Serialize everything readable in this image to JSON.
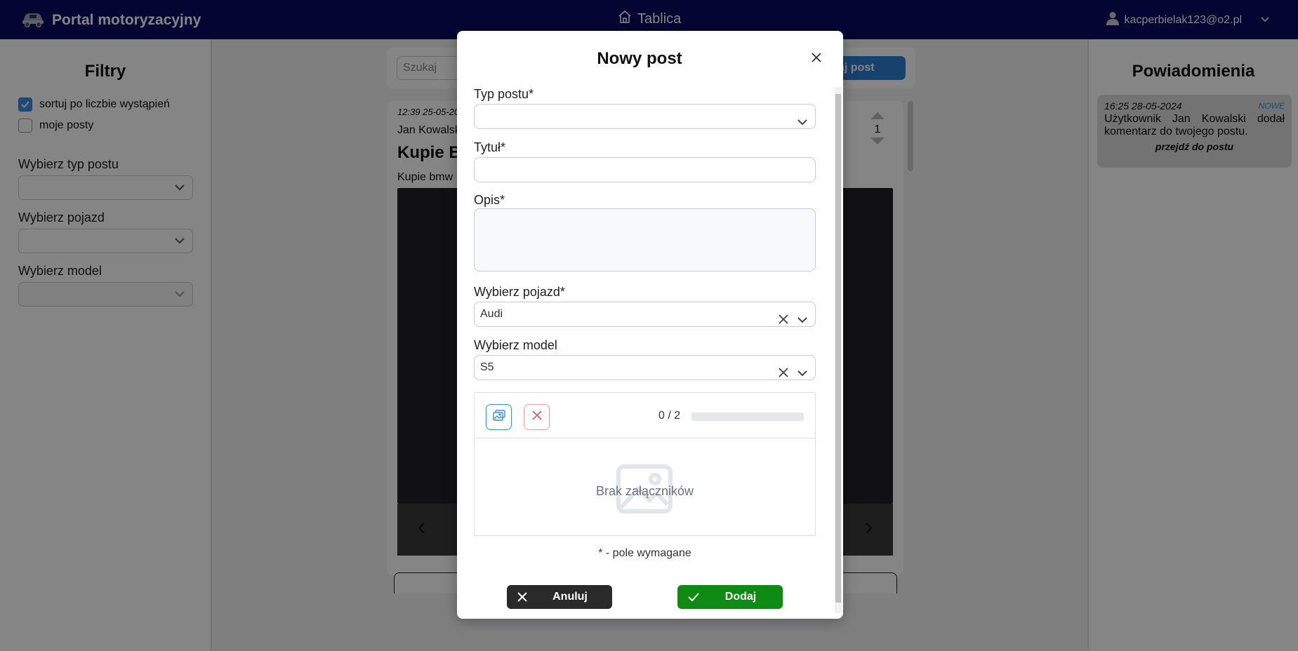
{
  "header": {
    "brand_title": "Portal motoryzacyjny",
    "center_link": "Tablica",
    "user_email": "kacperbielak123@o2.pl"
  },
  "filters": {
    "title": "Filtry",
    "sort_label": "sortuj po liczbie wystąpień",
    "my_posts_label": "moje posty",
    "post_type_label": "Wybierz typ postu",
    "vehicle_label": "Wybierz pojazd",
    "model_label": "Wybierz model"
  },
  "notifications": {
    "title": "Powiadomienia",
    "items": [
      {
        "timestamp": "16:25 28-05-2024",
        "badge": "NOWE",
        "message": "Użytkownik Jan Kowalski dodał komentarz do twojego postu.",
        "link": "przejdź do postu"
      }
    ]
  },
  "main": {
    "search_placeholder": "Szukaj",
    "add_post_label": "odaj post",
    "post": {
      "timestamp": "12:39 25-05-20",
      "author": "Jan Kowalsk",
      "title": "Kupie B",
      "description": "Kupie bmw",
      "votes": "1"
    }
  },
  "modal": {
    "title": "Nowy post",
    "post_type_label": "Typ postu*",
    "title_label": "Tytuł*",
    "description_label": "Opis*",
    "vehicle_label": "Wybierz pojazd*",
    "vehicle_value": "Audi",
    "model_label": "Wybierz model",
    "model_value": "S5",
    "attachments_count": "0 / 2",
    "attachments_progress": 0,
    "no_attachments": "Brak załączników",
    "required_note": "* - pole wymagane",
    "cancel_label": "Anuluj",
    "add_label": "Dodaj"
  },
  "colors": {
    "header_bg": "#0a0a64",
    "accent": "#2c7fd1",
    "add_button": "#0f8a12",
    "cancel_button": "#2a2a2a"
  }
}
